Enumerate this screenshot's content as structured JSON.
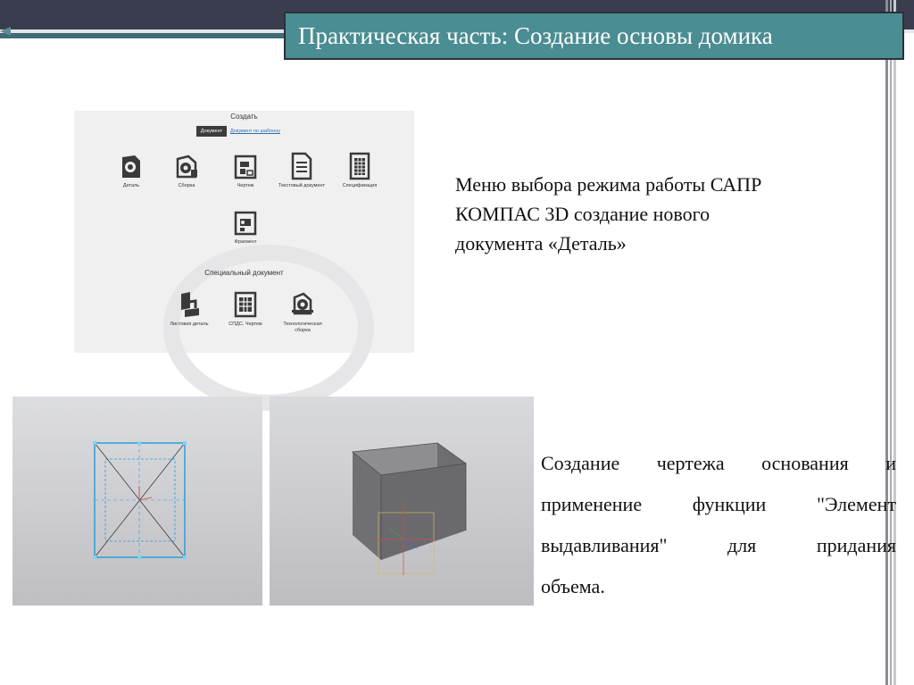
{
  "slide": {
    "title": "Практическая часть: Создание основы домика",
    "description_1": "Меню выбора режима работы САПР КОМПАС 3D создание нового документа «Деталь»",
    "description_2_lines": [
      "Создание чертежа основания и",
      "применение функции \"Элемент",
      "выдавливания\" для придания",
      "объема."
    ]
  },
  "create_menu": {
    "heading": "Создать",
    "tab_document": "Документ",
    "tab_template": "Документ по шаблону",
    "items": [
      {
        "label": "Деталь",
        "icon": "part-icon"
      },
      {
        "label": "Сборка",
        "icon": "assembly-icon"
      },
      {
        "label": "Чертеж",
        "icon": "drawing-icon"
      },
      {
        "label": "Текстовый документ",
        "icon": "text-document-icon"
      },
      {
        "label": "Спецификация",
        "icon": "specification-icon"
      },
      {
        "label": "Фрагмент",
        "icon": "fragment-icon"
      }
    ],
    "special_heading": "Специальный документ",
    "special_items": [
      {
        "label": "Листовая деталь",
        "icon": "sheet-part-icon"
      },
      {
        "label": "СПДС. Чертеж",
        "icon": "spds-drawing-icon"
      },
      {
        "label": "Технологическая сборка",
        "icon": "tech-assembly-icon"
      }
    ]
  },
  "colors": {
    "title_bg": "#4a8d93",
    "header_band": "#3a3d4d",
    "accent": "#3f6b74",
    "sketch_lines": "#2a9fd6"
  }
}
